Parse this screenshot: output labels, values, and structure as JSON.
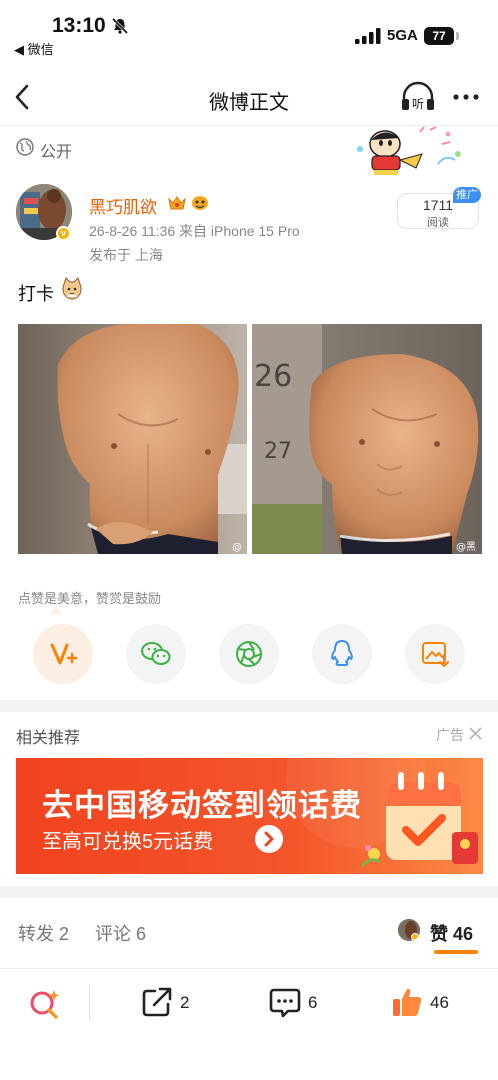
{
  "status_bar": {
    "time": "13:10",
    "back_app": "◀ 微信",
    "network": "5GA",
    "battery": "77"
  },
  "nav": {
    "title": "微博正文",
    "listen_label": "听"
  },
  "post": {
    "visibility": "公开",
    "author_name": "黑巧肌欲",
    "meta": "26-8-26 11:36   来自 iPhone 15 Pro",
    "location": "发布于 上海",
    "read_count": "1711",
    "read_label": "阅读",
    "promo_tag": "推广",
    "text": "打卡",
    "photo_watermark_1": "@",
    "photo_watermark_2": "@黑"
  },
  "reward": {
    "hint": "点赞是美意，赞赏是鼓励"
  },
  "related": {
    "title": "相关推荐",
    "ad_label": "广告",
    "banner_title": "去中国移动签到领话费",
    "banner_subtitle": "至高可兑换5元话费"
  },
  "tabs": {
    "repost": "转发 2",
    "comment": "评论 6",
    "like": "赞 46"
  },
  "bottom_bar": {
    "repost_count": "2",
    "comment_count": "6",
    "like_count": "46"
  },
  "colors": {
    "accent": "#ff8200",
    "author": "#e8600c",
    "banner": "#f04a23",
    "promo_tag": "#3d8ff0"
  }
}
